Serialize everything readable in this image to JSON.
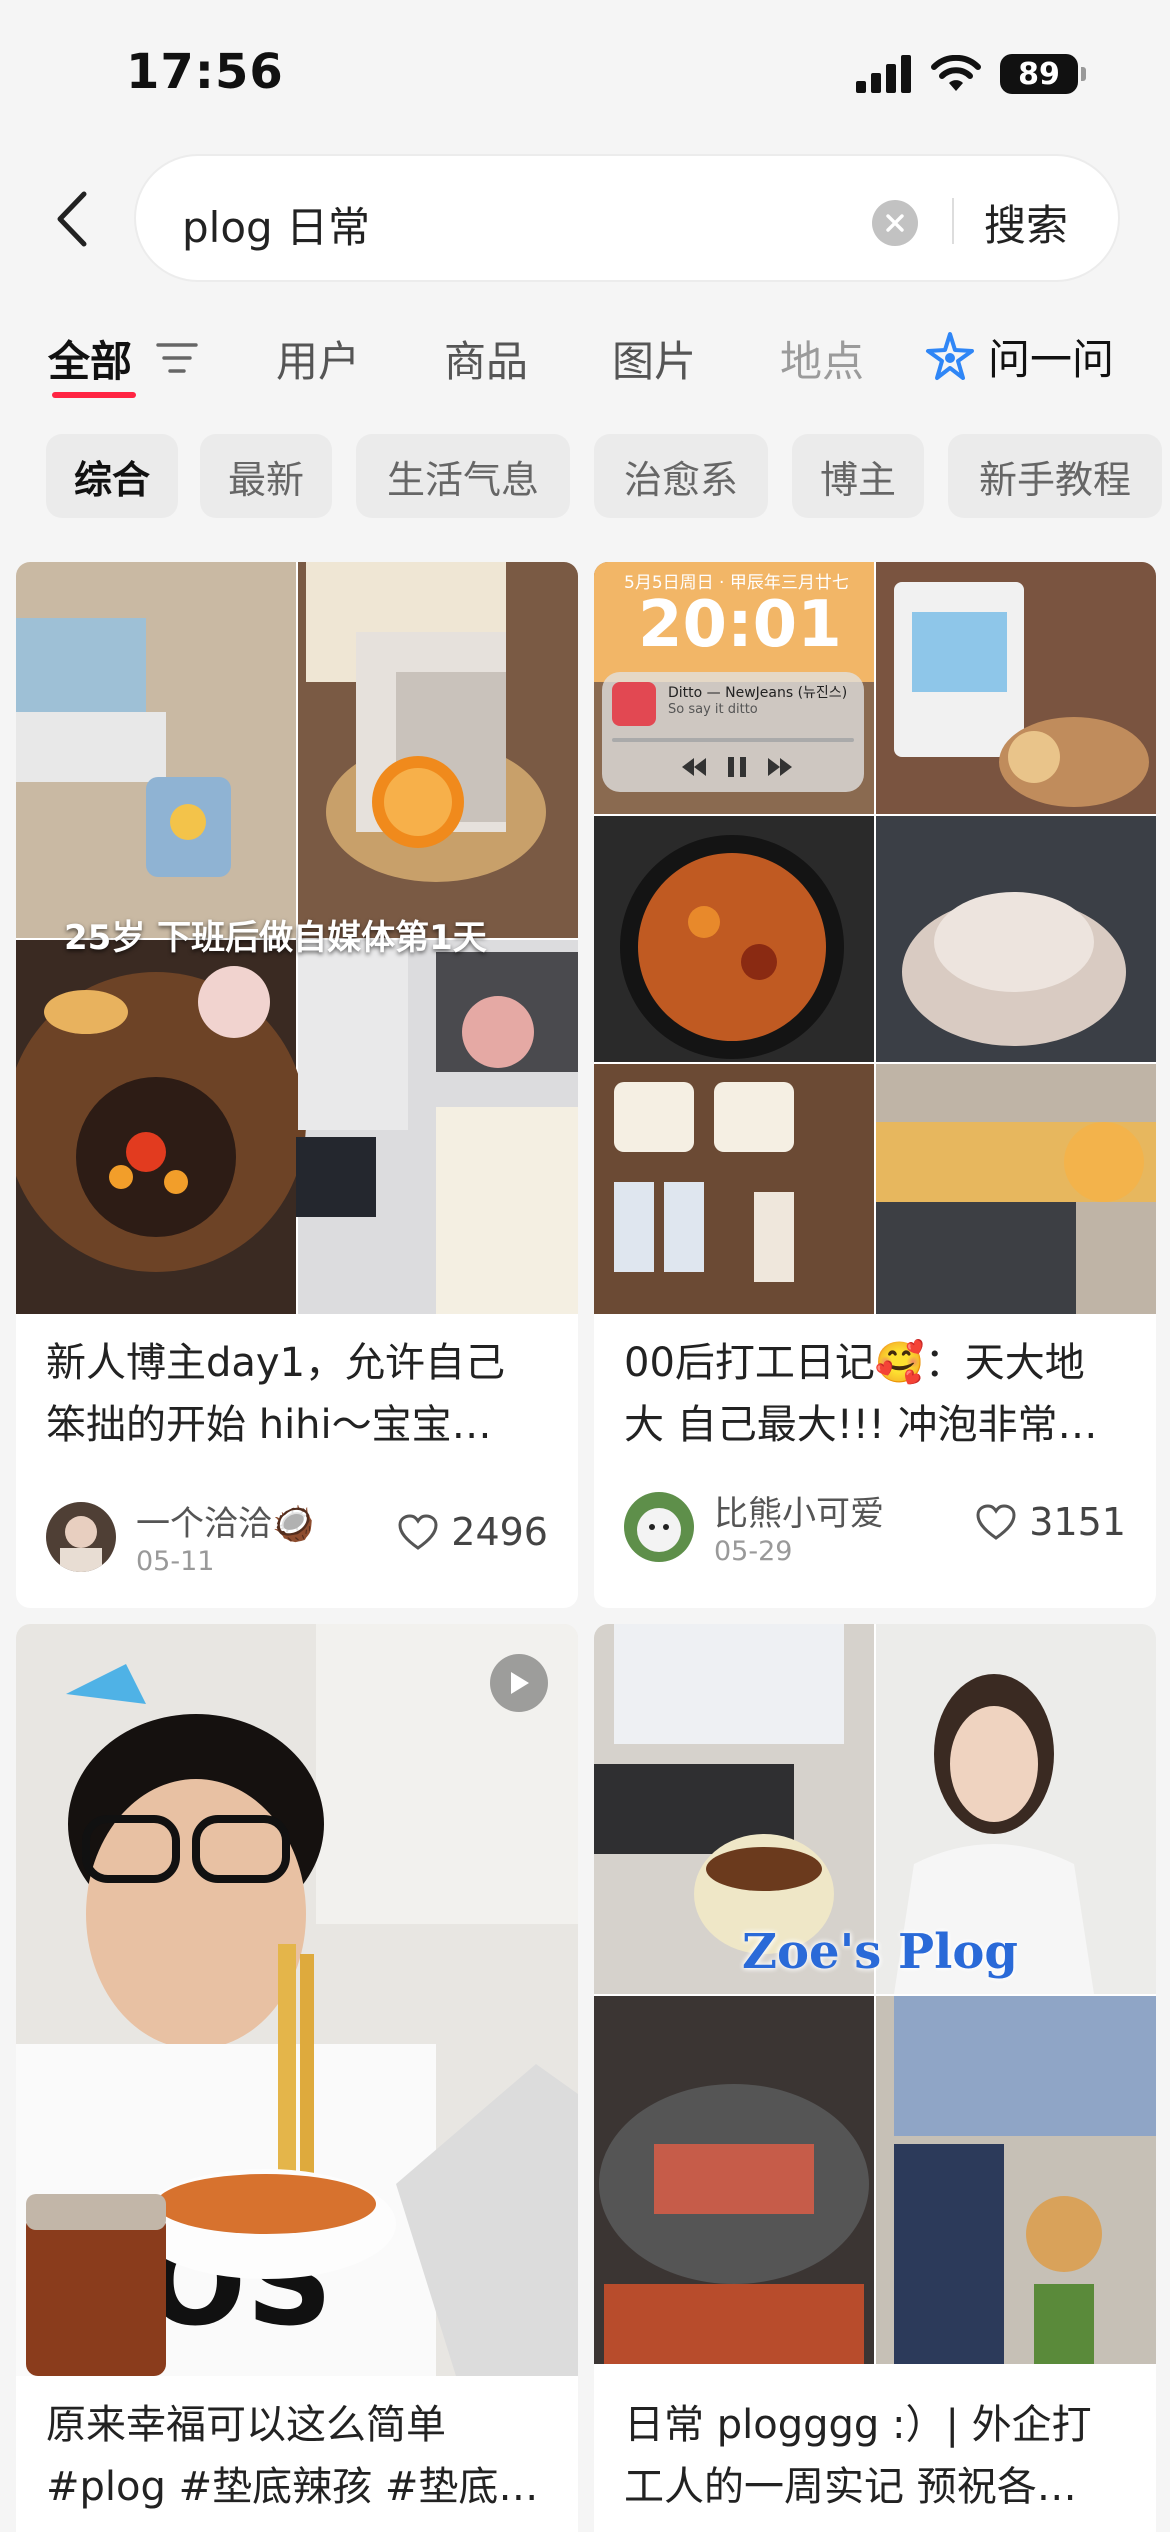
{
  "status_bar": {
    "time": "17:56",
    "battery": "89"
  },
  "search": {
    "query": "plog 日常",
    "button_label": "搜索"
  },
  "tabs": [
    {
      "label": "全部",
      "active": true
    },
    {
      "label": "用户"
    },
    {
      "label": "商品"
    },
    {
      "label": "图片"
    },
    {
      "label": "地点"
    }
  ],
  "ask_label": "问一问",
  "chips": [
    {
      "label": "综合",
      "active": true
    },
    {
      "label": "最新"
    },
    {
      "label": "生活气息"
    },
    {
      "label": "治愈系"
    },
    {
      "label": "博主"
    },
    {
      "label": "新手教程"
    }
  ],
  "cards": [
    {
      "image_caption": "25岁 下班后做自媒体第1天",
      "title_line1": "新人博主day1，允许自己",
      "title_line2": "笨拙的开始 hihi～宝宝…",
      "author": "一个洽洽🥥",
      "date": "05-11",
      "likes": "2496"
    },
    {
      "image_date": "5月5日周日 · 甲辰年三月廿七",
      "image_time": "20:01",
      "music_title": "Ditto — NewJeans (뉴진스)",
      "music_sub": "So say it ditto",
      "title_line1": "00后打工日记🥰：天大地",
      "title_line2": "大 自己最大!!! 冲泡非常…",
      "author": "比熊小可爱",
      "date": "05-29",
      "likes": "3151"
    },
    {
      "title_line1": "原来幸福可以这么简单",
      "title_line2": "#plog  #垫底辣孩  #垫底…"
    },
    {
      "image_caption": "Zoe's Plog",
      "title_line1": "日常 plogggg :）| 外企打",
      "title_line2": "工人的一周实记 预祝各…"
    }
  ],
  "colors": {
    "accent": "#ff2442",
    "chip_bg": "#ebebeb",
    "page_bg": "#f5f5f5"
  }
}
